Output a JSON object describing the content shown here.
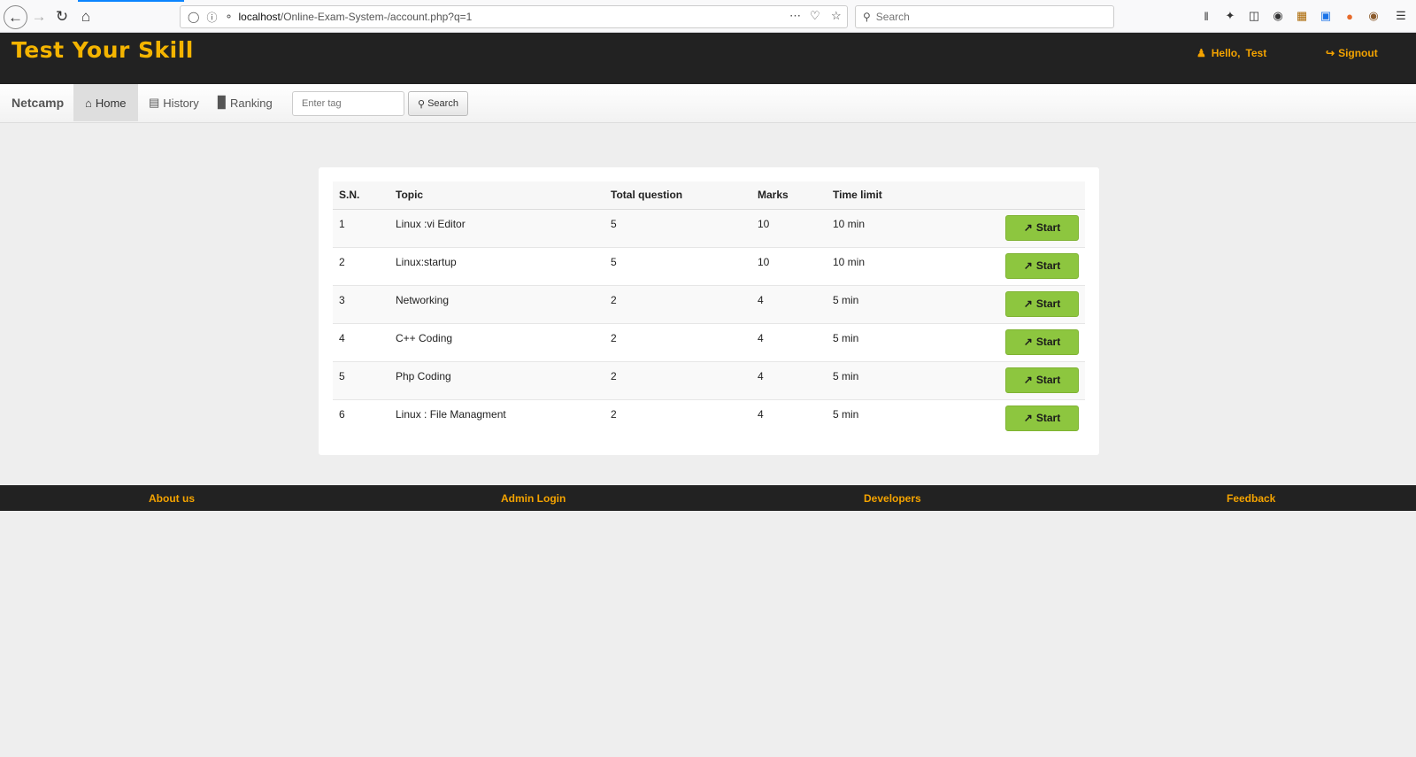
{
  "browser": {
    "url_host": "localhost",
    "url_path": "/Online-Exam-System-/account.php?q=1",
    "search_placeholder": "Search"
  },
  "header": {
    "logo": "Test Your Skill",
    "hello_label": "Hello,",
    "user_name": "Test",
    "signout_label": "Signout"
  },
  "nav": {
    "brand": "Netcamp",
    "home": "Home",
    "history": "History",
    "ranking": "Ranking",
    "tag_placeholder": "Enter tag",
    "search_label": "Search"
  },
  "table": {
    "headers": [
      "S.N.",
      "Topic",
      "Total question",
      "Marks",
      "Time limit"
    ],
    "rows": [
      {
        "sn": "1",
        "topic": "Linux :vi Editor",
        "total": "5",
        "marks": "10",
        "time": "10 min",
        "action": "Start"
      },
      {
        "sn": "2",
        "topic": "Linux:startup",
        "total": "5",
        "marks": "10",
        "time": "10 min",
        "action": "Start"
      },
      {
        "sn": "3",
        "topic": "Networking",
        "total": "2",
        "marks": "4",
        "time": "5 min",
        "action": "Start"
      },
      {
        "sn": "4",
        "topic": "C++ Coding",
        "total": "2",
        "marks": "4",
        "time": "5 min",
        "action": "Start"
      },
      {
        "sn": "5",
        "topic": "Php Coding",
        "total": "2",
        "marks": "4",
        "time": "5 min",
        "action": "Start"
      },
      {
        "sn": "6",
        "topic": "Linux : File Managment",
        "total": "2",
        "marks": "4",
        "time": "5 min",
        "action": "Start"
      }
    ]
  },
  "footer": {
    "about": "About us",
    "admin": "Admin Login",
    "developers": "Developers",
    "feedback": "Feedback"
  },
  "colors": {
    "brand_yellow": "#f4b400",
    "link_orange": "#f4a300",
    "header_bg": "#222222",
    "start_green": "#8dc63f"
  }
}
